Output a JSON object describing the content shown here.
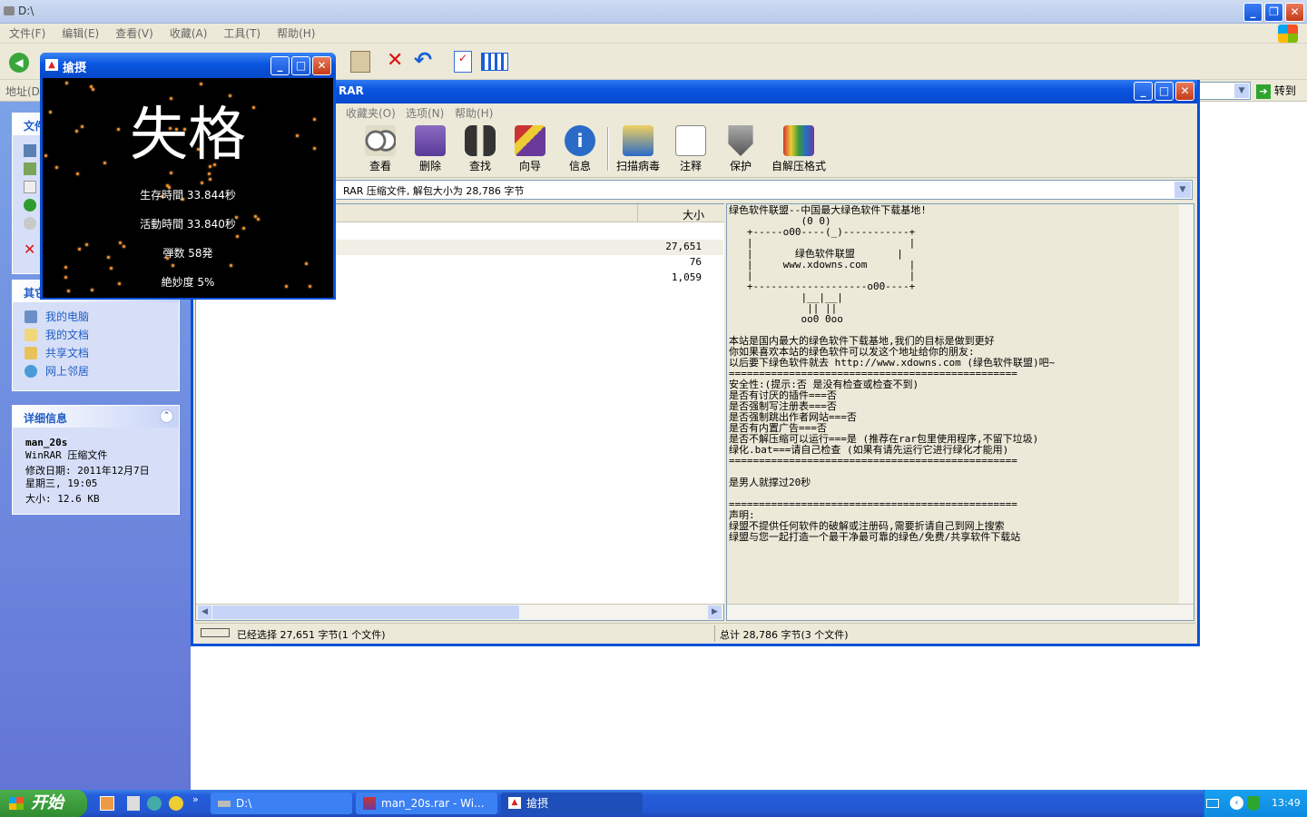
{
  "explorer": {
    "title": "D:\\",
    "menu": [
      "文件(F)",
      "编辑(E)",
      "查看(V)",
      "收藏(A)",
      "工具(T)",
      "帮助(H)"
    ],
    "address_label": "地址(D)",
    "go_label": "转到",
    "left_panel": {
      "tasks_title": "文件",
      "other_title": "其它",
      "other_links": [
        "我的电脑",
        "我的文档",
        "共享文档",
        "网上邻居"
      ],
      "details_title": "详细信息",
      "details": {
        "name": "man_20s",
        "type": "WinRAR 压缩文件",
        "modified": "修改日期: 2011年12月7日",
        "weekday_time": "星期三, 19:05",
        "size": "大小: 12.6 KB"
      }
    }
  },
  "winrar": {
    "title": "RAR",
    "menu": [
      "收藏夹(O)",
      "选项(N)",
      "帮助(H)"
    ],
    "toolbar": [
      "查看",
      "删除",
      "查找",
      "向导",
      "信息",
      "扫描病毒",
      "注释",
      "保护",
      "自解压格式"
    ],
    "path_text": "RAR 压缩文件, 解包大小为 28,786 字节",
    "list": {
      "size_header": "大小",
      "sizes": [
        "",
        "27,651",
        "76",
        "1,059"
      ]
    },
    "preview_lines": [
      "绿色软件联盟--中国最大绿色软件下载基地!",
      "            (0 0)",
      "   +-----o00----(_)-----------+",
      "   |                          |",
      "   |       绿色软件联盟       |",
      "   |     www.xdowns.com       |",
      "   |                          |",
      "   +-------------------o00----+",
      "            |__|__|",
      "             || ||",
      "            oo0 0oo",
      "",
      "本站是国内最大的绿色软件下载基地,我们的目标是做到更好",
      "你如果喜欢本站的绿色软件可以发这个地址给你的朋友:",
      "以后要下绿色软件就去 http://www.xdowns.com (绿色软件联盟)吧~",
      "================================================",
      "安全性:(提示:否 是没有检查或检查不到)",
      "是否有讨厌的插件===否",
      "是否强制写注册表===否",
      "是否强制跳出作者网站===否",
      "是否有内置广告===否",
      "是否不解压缩可以运行===是 (推荐在rar包里使用程序,不留下垃圾)",
      "绿化.bat===请自己检查 (如果有请先运行它进行绿化才能用)",
      "================================================",
      "",
      "是男人就撑过20秒",
      "",
      "================================================",
      "声明:",
      "绿盟不提供任何软件的破解或注册码,需要折请自己到网上搜索",
      "绿盟与您一起打造一个最干净最可靠的绿色/免费/共享软件下载站"
    ],
    "status_left": "已经选择 27,651 字节(1 个文件)",
    "status_right": "总计 28,786 字节(3 个文件)"
  },
  "game": {
    "title": "搶摂",
    "big_text": "失格",
    "stats": [
      "生存時間 33.844秒",
      "活動時間 33.840秒",
      "弾数 58発",
      "絶妙度 5%"
    ]
  },
  "taskbar": {
    "start_label": "开始",
    "tasks": [
      "D:\\",
      "man_20s.rar - Wi...",
      "搶摂"
    ],
    "clock": "13:49"
  },
  "colors": {
    "xp_blue": "#0a50d8",
    "panel_bg": "#d6dff7",
    "link_blue": "#215dc6",
    "bullet": "#ff8a2a"
  }
}
